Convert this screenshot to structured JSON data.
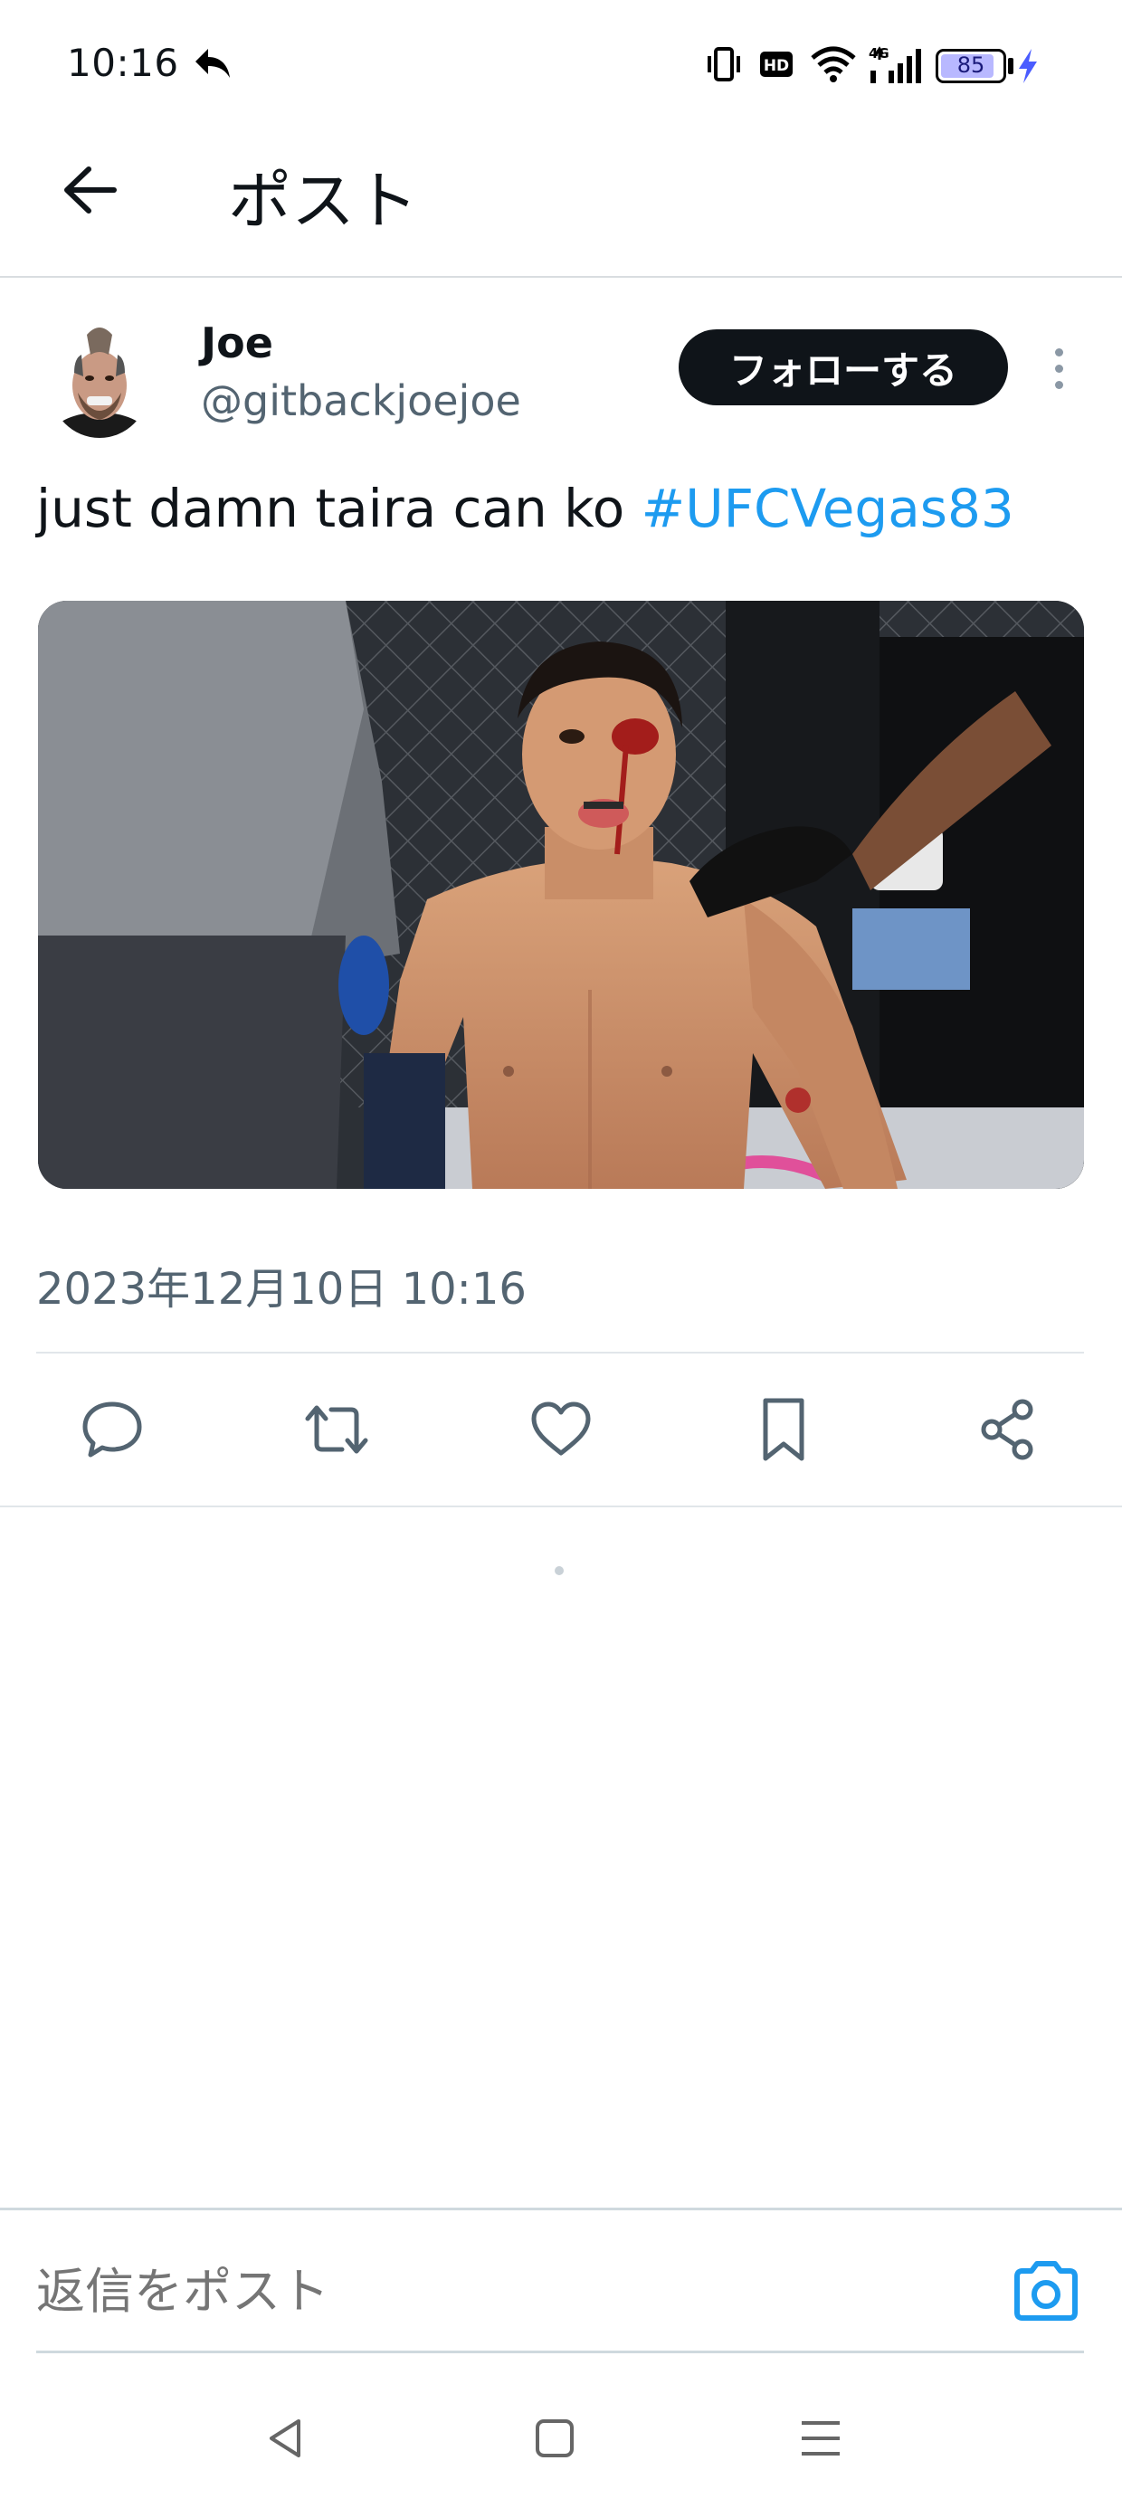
{
  "status_bar": {
    "time": "10:16",
    "battery_level": "85",
    "network": "4G"
  },
  "header": {
    "title": "ポスト"
  },
  "post": {
    "author_name": "Joe",
    "author_handle": "@gitbackjoejoe",
    "follow_label": "フォローする",
    "text": "just damn taira can ko ",
    "hashtag": "#UFCVegas83",
    "timestamp": "2023年12月10日 10:16"
  },
  "composer": {
    "placeholder": "返信をポスト"
  },
  "icons": {
    "back": "arrow-left-icon",
    "reply": "speech-bubble-icon",
    "repost": "repost-arrows-icon",
    "like": "heart-icon",
    "bookmark": "bookmark-icon",
    "share": "share-nodes-icon",
    "camera": "camera-icon"
  },
  "colors": {
    "accent": "#1d9bf0",
    "text_primary": "#0f1419",
    "text_secondary": "#536471",
    "follow_bg": "#0f1419"
  }
}
